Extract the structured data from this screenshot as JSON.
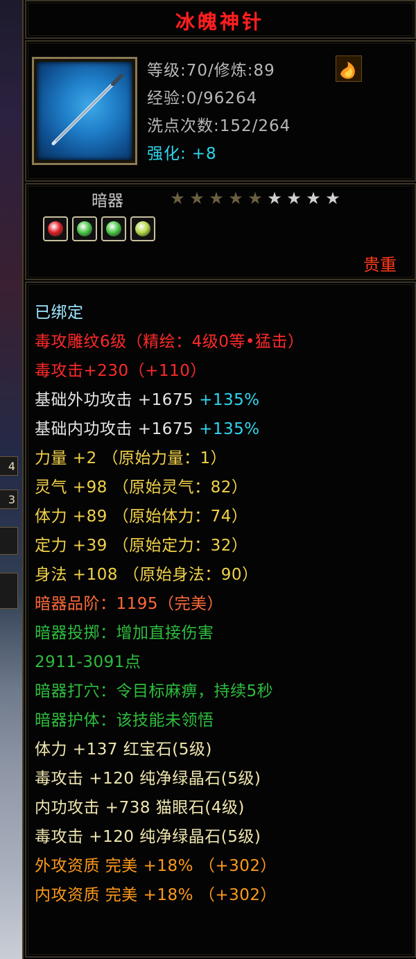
{
  "item": {
    "name": "冰魄神针",
    "level_line": "等级:70/修炼:89",
    "exp_line": "经验:0/96264",
    "reset_line": "洗点次数:152/264",
    "enhance_label": "强化:",
    "enhance_value": "+8",
    "type": "暗器",
    "stars_lit": 5,
    "stars_total": 9,
    "rarity": "贵重"
  },
  "gems": [
    {
      "name": "red-gem",
      "color": "#e0202a"
    },
    {
      "name": "green-gem",
      "color": "#4ec84a"
    },
    {
      "name": "green-gem",
      "color": "#4ec84a"
    },
    {
      "name": "yellow-green-gem",
      "color": "#b8d84a"
    }
  ],
  "attributes": [
    {
      "text": "已绑定",
      "color": "lightcyan"
    },
    {
      "text": "毒攻雕纹6级（精绘：4级0等•猛击）",
      "color": "red"
    },
    {
      "text": "毒攻击+230（+110）",
      "color": "red"
    },
    {
      "text": "基础外功攻击 +1675",
      "extra": "+135%",
      "color": "white"
    },
    {
      "text": "基础内功攻击 +1675",
      "extra": "+135%",
      "color": "white"
    },
    {
      "text": "力量 +2 （原始力量：1）",
      "color": "yellow"
    },
    {
      "text": "灵气 +98 （原始灵气：82）",
      "color": "yellow"
    },
    {
      "text": "体力 +89 （原始体力：74）",
      "color": "yellow"
    },
    {
      "text": "定力 +39 （原始定力：32）",
      "color": "yellow"
    },
    {
      "text": "身法 +108 （原始身法：90）",
      "color": "yellow"
    },
    {
      "text": "暗器品阶：1195（完美）",
      "color": "orangered"
    },
    {
      "text": "暗器投掷：增加直接伤害",
      "color": "green"
    },
    {
      "text": "2911-3091点",
      "color": "green"
    },
    {
      "text": "暗器打穴：令目标麻痹，持续5秒",
      "color": "green"
    },
    {
      "text": "暗器护体：该技能未领悟",
      "color": "green"
    },
    {
      "text": "体力 +137 红宝石(5级)",
      "color": "lightyellow"
    },
    {
      "text": "毒攻击 +120 纯净绿晶石(5级)",
      "color": "lightyellow"
    },
    {
      "text": "内功攻击 +738 猫眼石(4级)",
      "color": "lightyellow"
    },
    {
      "text": "毒攻击 +120 纯净绿晶石(5级)",
      "color": "lightyellow"
    },
    {
      "text": "外攻资质  完美 +18% （+302）",
      "color": "orange"
    },
    {
      "text": "内攻资质  完美 +18% （+302）",
      "color": "orange"
    }
  ],
  "left_strip": {
    "chip_1": "4",
    "chip_2": "3"
  }
}
